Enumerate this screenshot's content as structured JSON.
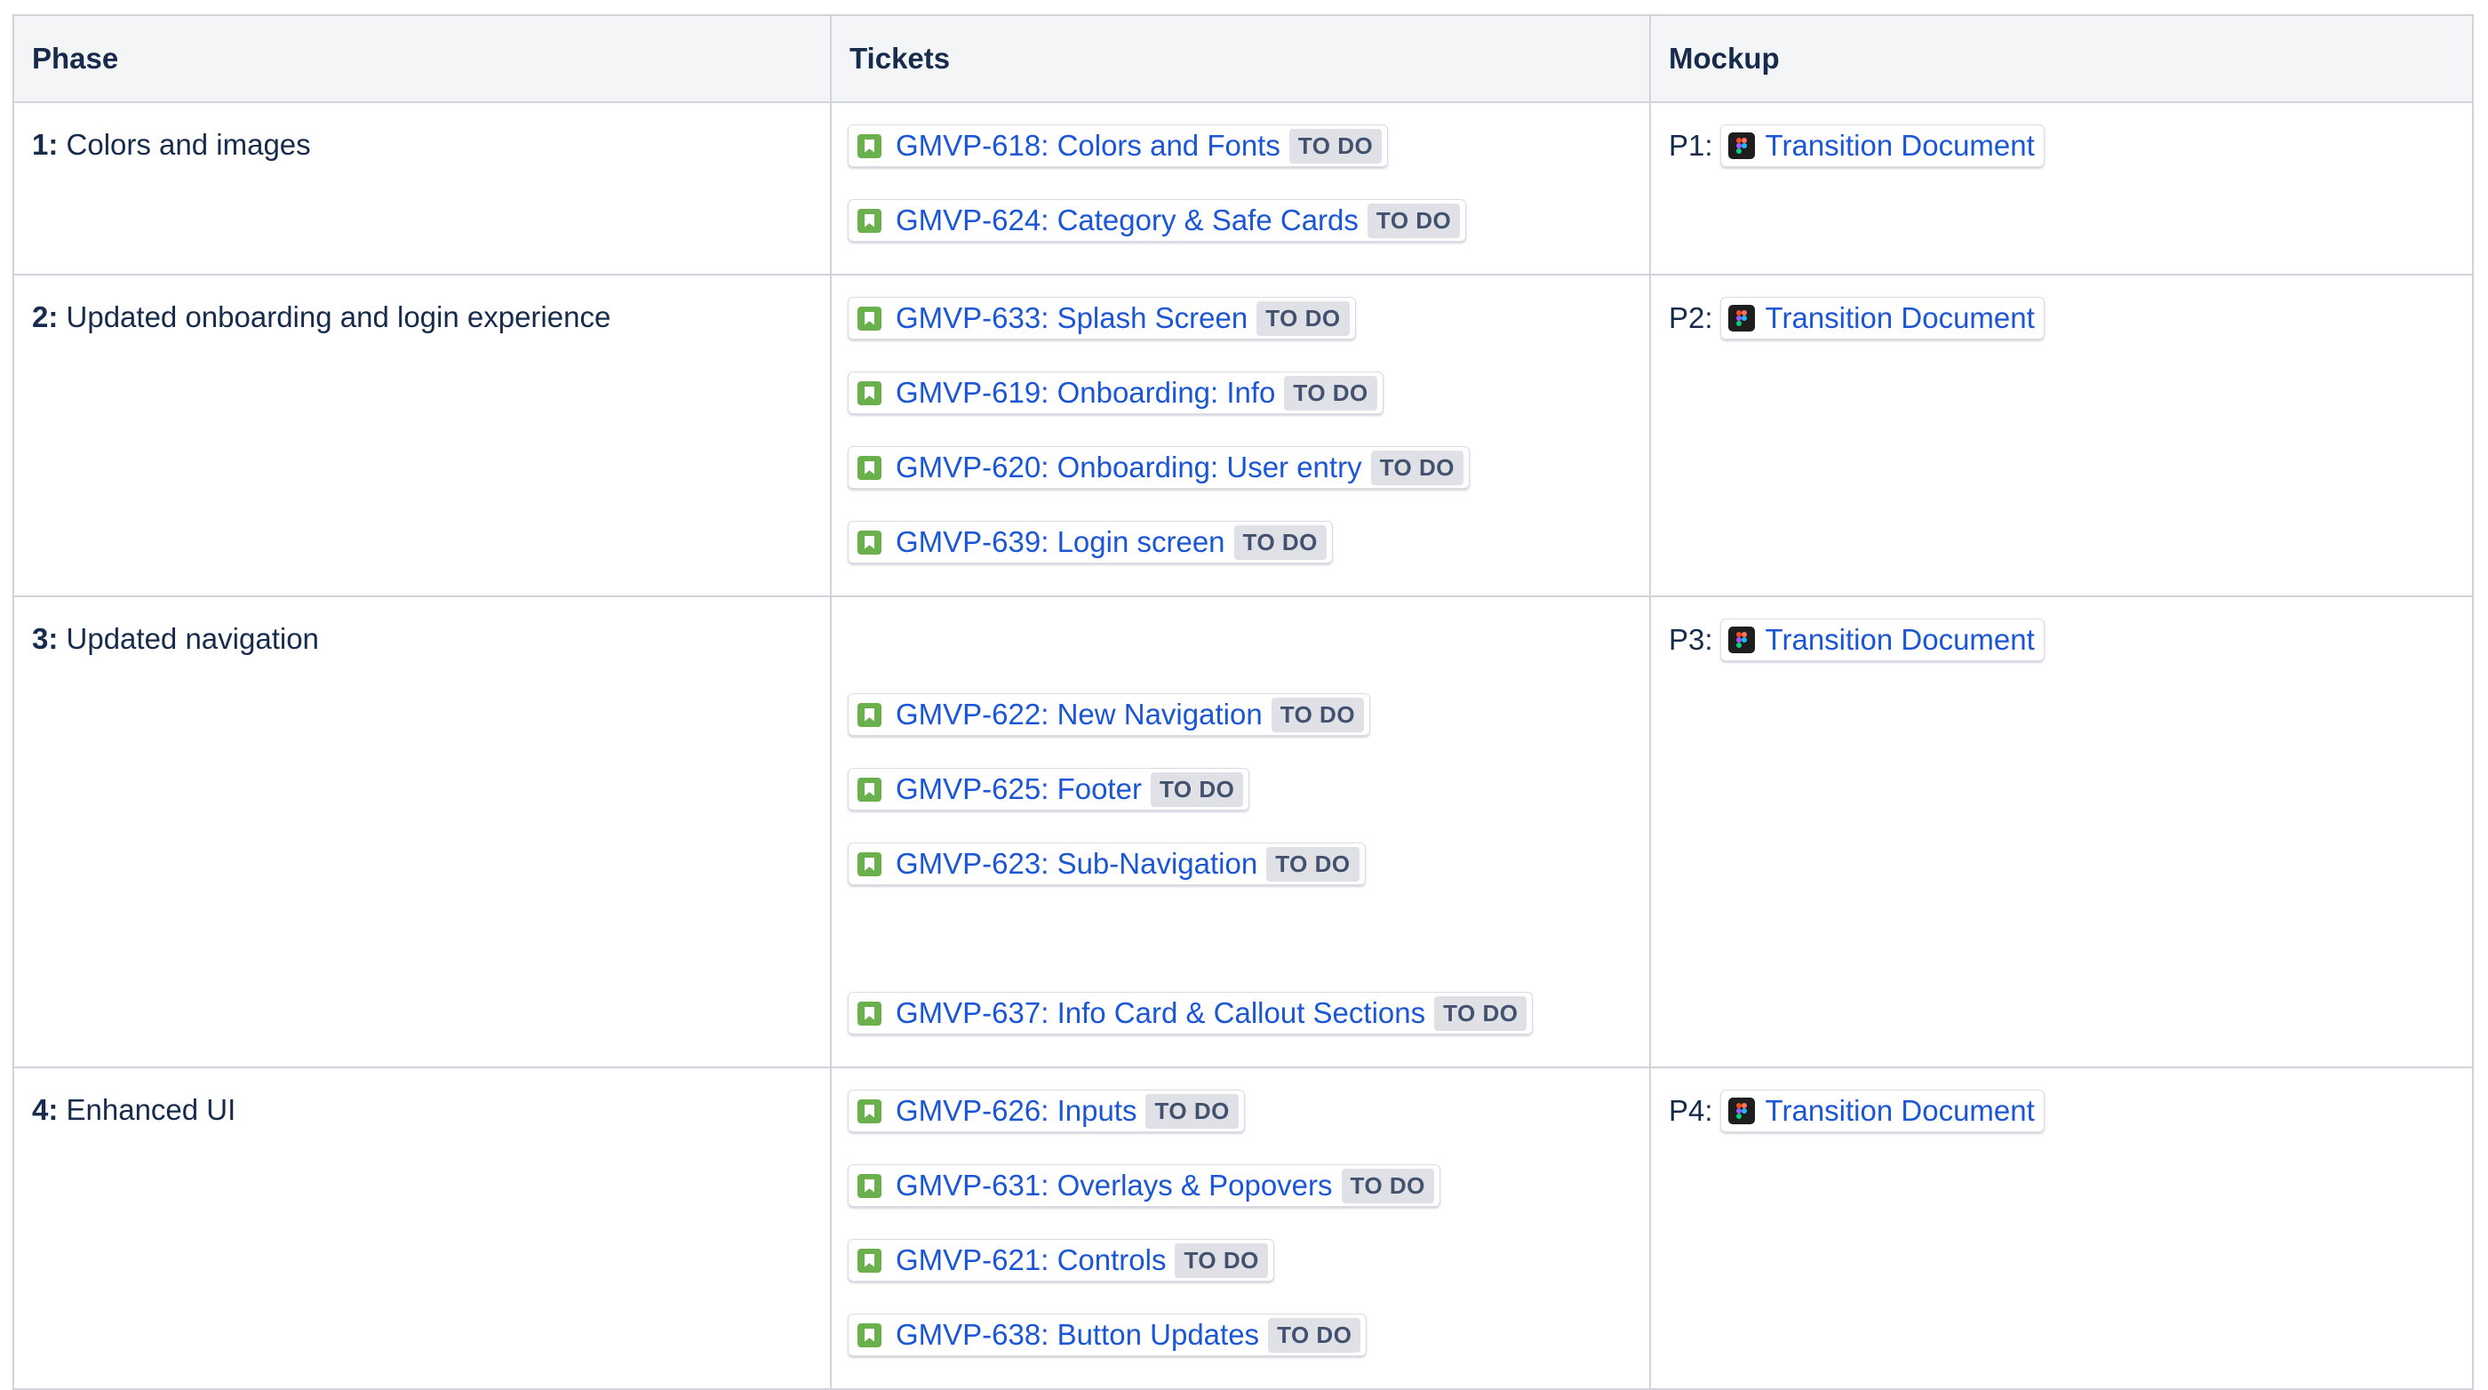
{
  "table": {
    "headers": [
      "Phase",
      "Tickets",
      "Mockup"
    ],
    "rows": [
      {
        "phase": {
          "number": "1:",
          "text": " Colors and images"
        },
        "tickets": [
          {
            "label": "GMVP-618: Colors and Fonts",
            "status": "TO DO"
          },
          {
            "label": "GMVP-624: Category & Safe Cards",
            "status": "TO DO"
          }
        ],
        "mockup": {
          "prefix": "P1:",
          "link": "Transition Document",
          "icon": "figma-icon"
        }
      },
      {
        "phase": {
          "number": "2:",
          "text": " Updated onboarding and login experience"
        },
        "tickets": [
          {
            "label": "GMVP-633: Splash Screen",
            "status": "TO DO"
          },
          {
            "label": "GMVP-619: Onboarding: Info",
            "status": "TO DO"
          },
          {
            "label": "GMVP-620: Onboarding: User entry",
            "status": "TO DO"
          },
          {
            "label": "GMVP-639: Login screen",
            "status": "TO DO"
          }
        ],
        "mockup": {
          "prefix": "P2:",
          "link": "Transition Document",
          "icon": "figma-icon"
        }
      },
      {
        "phase": {
          "number": "3:",
          "text": " Updated navigation"
        },
        "tickets": [
          {
            "label": "GMVP-622: New Navigation",
            "status": "TO DO"
          },
          {
            "label": "GMVP-625: Footer",
            "status": "TO DO"
          },
          {
            "label": "GMVP-623: Sub-Navigation",
            "status": "TO DO"
          },
          {
            "label": "GMVP-637: Info Card & Callout Sections",
            "status": "TO DO"
          }
        ],
        "mockup": {
          "prefix": "P3:",
          "link": "Transition Document",
          "icon": "figma-icon"
        }
      },
      {
        "phase": {
          "number": "4:",
          "text": " Enhanced UI"
        },
        "tickets": [
          {
            "label": "GMVP-626: Inputs",
            "status": "TO DO"
          },
          {
            "label": "GMVP-631: Overlays & Popovers",
            "status": "TO DO"
          },
          {
            "label": "GMVP-621: Controls",
            "status": "TO DO"
          },
          {
            "label": "GMVP-638: Button Updates",
            "status": "TO DO"
          }
        ],
        "mockup": {
          "prefix": "P4:",
          "link": "Transition Document",
          "icon": "figma-icon"
        }
      }
    ]
  },
  "colors": {
    "link": "#1a56d6",
    "ticket_icon": "#6ab04c",
    "status_bg": "#dfe1e6",
    "header_bg": "#f4f5f7",
    "border": "#d1d5db"
  }
}
